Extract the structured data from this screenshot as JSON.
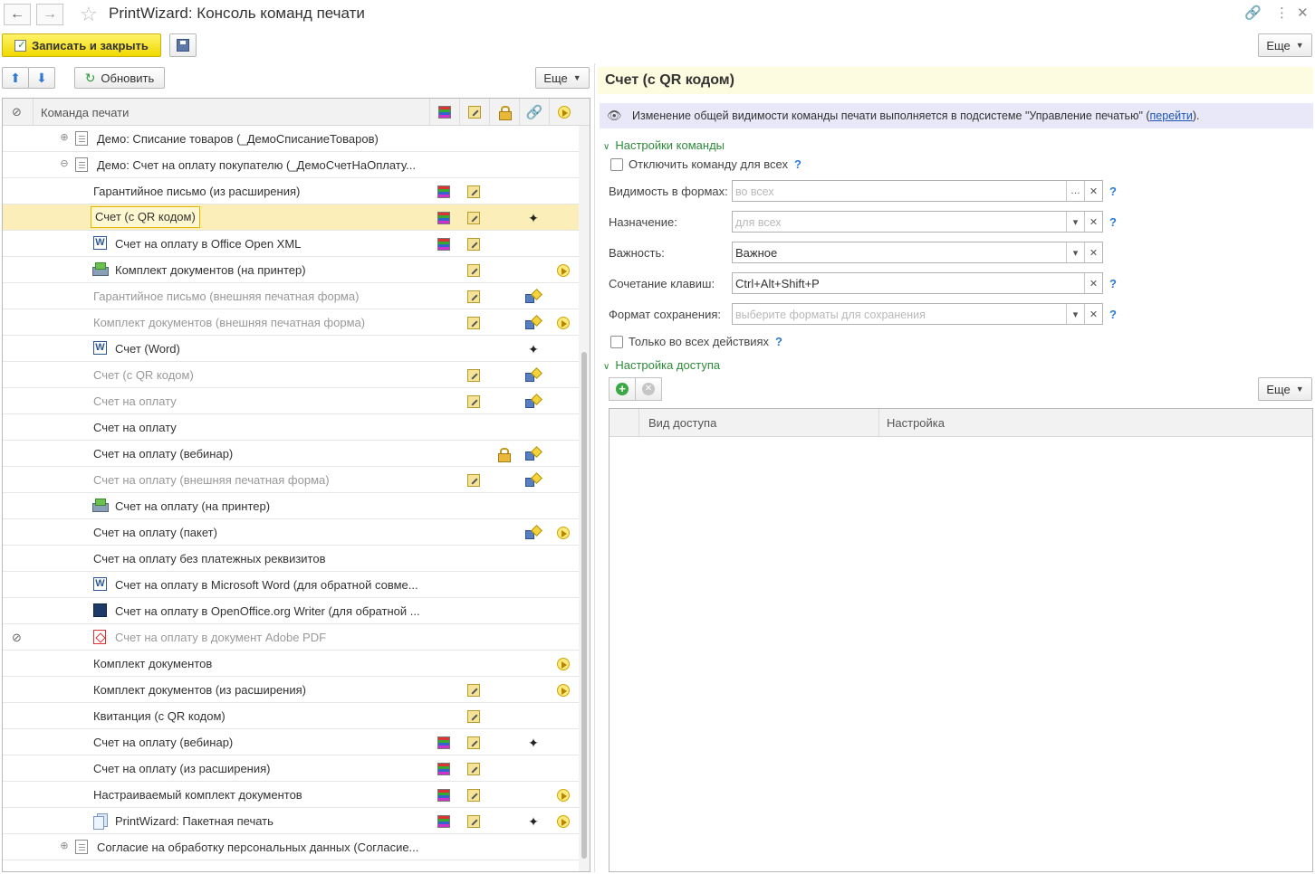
{
  "window": {
    "title": "PrintWizard: Консоль команд печати"
  },
  "toolbar": {
    "save_close_label": "Записать и закрыть",
    "more_label": "Еще"
  },
  "tree_toolbar": {
    "refresh_label": "Обновить",
    "more_label": "Еще"
  },
  "tree": {
    "header": "Команда печати",
    "rows": [
      {
        "text": "Демо: Списание товаров (_ДемоСписаниеТоваров)"
      },
      {
        "text": "Демо: Счет на оплату покупателю (_ДемоСчетНаОплату..."
      },
      {
        "text": "Гарантийное письмо (из расширения)"
      },
      {
        "text": "Счет (с QR кодом)"
      },
      {
        "text": "Счет на оплату в Office Open XML"
      },
      {
        "text": "Комплект документов (на принтер)"
      },
      {
        "text": "Гарантийное письмо (внешняя печатная форма)"
      },
      {
        "text": "Комплект документов (внешняя печатная форма)"
      },
      {
        "text": "Счет (Word)"
      },
      {
        "text": "Счет (с QR кодом)"
      },
      {
        "text": "Счет на оплату"
      },
      {
        "text": "Счет на оплату"
      },
      {
        "text": "Счет на оплату (вебинар)"
      },
      {
        "text": "Счет на оплату (внешняя печатная форма)"
      },
      {
        "text": "Счет на оплату (на принтер)"
      },
      {
        "text": "Счет на оплату (пакет)"
      },
      {
        "text": "Счет на оплату без платежных реквизитов"
      },
      {
        "text": "Счет на оплату в Microsoft Word (для обратной совме..."
      },
      {
        "text": "Счет на оплату в OpenOffice.org Writer (для обратной ..."
      },
      {
        "text": "Счет на оплату в документ Adobe PDF"
      },
      {
        "text": "Комплект документов"
      },
      {
        "text": "Комплект документов (из расширения)"
      },
      {
        "text": "Квитанция (с QR кодом)"
      },
      {
        "text": "Счет на оплату (вебинар)"
      },
      {
        "text": "Счет на оплату (из расширения)"
      },
      {
        "text": "Настраиваемый комплект документов"
      },
      {
        "text": "PrintWizard: Пакетная печать"
      },
      {
        "text": "Согласие на обработку персональных данных (Согласие..."
      }
    ]
  },
  "details": {
    "title": "Счет (с QR кодом)",
    "info_text": "Изменение общей видимости команды печати выполняется в подсистеме \"Управление печатью\" (",
    "info_link": "перейти",
    "info_tail": ").",
    "group_command": "Настройки команды",
    "disable_label": "Отключить команду для всех",
    "visibility_label": "Видимость в формах:",
    "visibility_placeholder": "во всех",
    "purpose_label": "Назначение:",
    "purpose_placeholder": "для всех",
    "importance_label": "Важность:",
    "importance_value": "Важное",
    "hotkey_label": "Сочетание клавиш:",
    "hotkey_value": "Ctrl+Alt+Shift+P",
    "format_label": "Формат сохранения:",
    "format_placeholder": "выберите форматы для сохранения",
    "only_all_label": "Только во всех действиях",
    "help_mark": "?",
    "group_access": "Настройка доступа",
    "access_more": "Еще",
    "col_access": "Вид доступа",
    "col_setting": "Настройка"
  }
}
